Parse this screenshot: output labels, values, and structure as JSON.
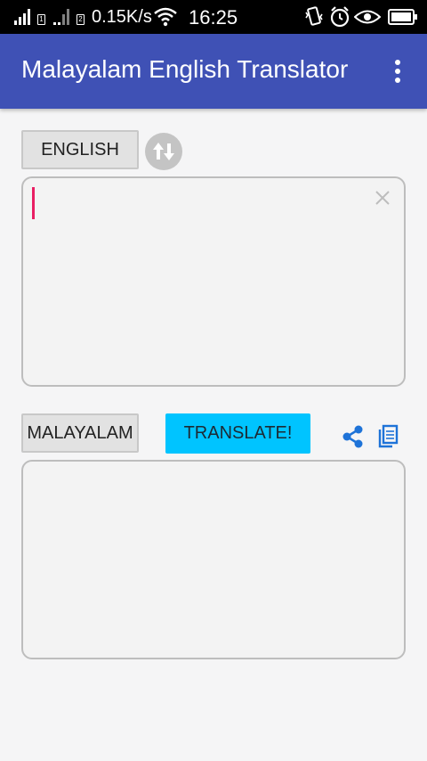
{
  "status_bar": {
    "net_speed": "0.15K/s",
    "time": "16:25",
    "sim1_label": "1",
    "sim2_label": "2"
  },
  "app_bar": {
    "title": "Malayalam English Translator"
  },
  "source": {
    "language_label": "ENGLISH",
    "input_value": "",
    "input_placeholder": ""
  },
  "target": {
    "language_label": "MALAYALAM",
    "output_text": ""
  },
  "actions": {
    "translate_label": "TRANSLATE!"
  },
  "icons": {
    "swap": "swap-vertical-icon",
    "clear": "close-icon",
    "share": "share-icon",
    "copy": "copy-icon",
    "overflow": "more-vert-icon"
  },
  "colors": {
    "app_bar": "#3f51b5",
    "translate_button": "#00c4ff",
    "cursor": "#e91e63",
    "icon_blue": "#1e73d8"
  }
}
